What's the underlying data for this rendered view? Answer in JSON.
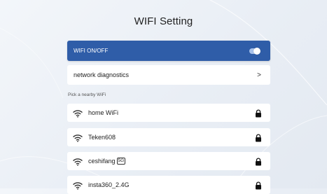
{
  "page": {
    "title": "WIFI Setting"
  },
  "toggle": {
    "label": "WIFI ON/OFF",
    "enabled": true,
    "accent_color": "#2f5da8"
  },
  "diagnostics": {
    "label": "network diagnostics",
    "chevron": ">"
  },
  "networks_section": {
    "label": "Pick a nearby WiFi"
  },
  "networks": [
    {
      "name": "home WiFi",
      "badge": "",
      "icon": "wifi-signal-icon",
      "locked": true
    },
    {
      "name": "Teken608",
      "badge": "",
      "icon": "wifi-signal-icon",
      "locked": true
    },
    {
      "name": "ceshifang",
      "badge": "5G",
      "icon": "wifi-signal-icon",
      "locked": true
    },
    {
      "name": "insta360_2.4G",
      "badge": "",
      "icon": "wifi-signal-icon",
      "locked": true
    }
  ]
}
